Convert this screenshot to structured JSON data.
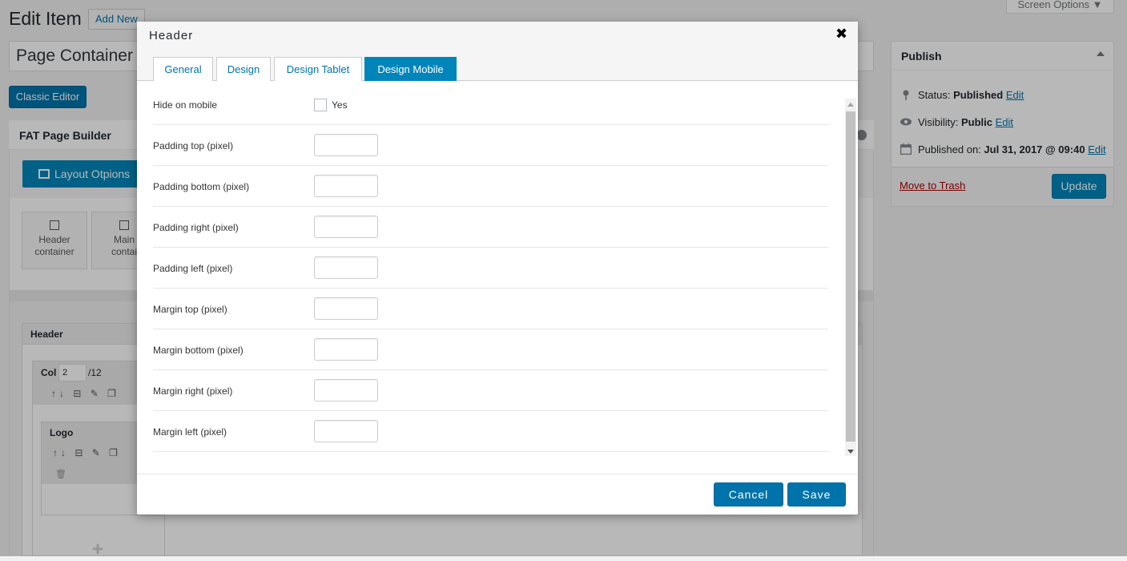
{
  "page": {
    "title": "Edit Item",
    "add_new": "Add New",
    "screen_options": "Screen Options ▼",
    "post_title": "Page Container",
    "classic_editor": "Classic Editor"
  },
  "builder": {
    "title": "FAT Page Builder",
    "layout_button": "Layout Otpions",
    "tiles": [
      {
        "line1": "Header",
        "line2": "container"
      },
      {
        "line1": "Main",
        "line2": "contai"
      }
    ],
    "header_panel_title": "Header",
    "col_label": "Col",
    "col_value": "2",
    "col_of": "/12",
    "logo_title": "Logo",
    "tools_glyphs": "↑↓ ⊟ ✎ ❐",
    "trash_glyph": "🗑",
    "plus_glyph": "+"
  },
  "publish": {
    "title": "Publish",
    "status_label": "Status:",
    "status_value": "Published",
    "visibility_label": "Visibility:",
    "visibility_value": "Public",
    "published_label": "Published on:",
    "published_value": "Jul 31, 2017 @ 09:40",
    "edit_link": "Edit",
    "trash": "Move to Trash",
    "update": "Update"
  },
  "modal": {
    "title": "Header",
    "close_glyph": "✖",
    "tabs": [
      {
        "label": "General",
        "active": false
      },
      {
        "label": "Design",
        "active": false
      },
      {
        "label": "Design Tablet",
        "active": false
      },
      {
        "label": "Design Mobile",
        "active": true
      }
    ],
    "hide_label": "Hide on mobile",
    "hide_checkbox_label": "Yes",
    "fields": [
      {
        "label": "Padding top (pixel)",
        "value": ""
      },
      {
        "label": "Padding bottom (pixel)",
        "value": ""
      },
      {
        "label": "Padding right (pixel)",
        "value": ""
      },
      {
        "label": "Padding left (pixel)",
        "value": ""
      },
      {
        "label": "Margin top (pixel)",
        "value": ""
      },
      {
        "label": "Margin bottom (pixel)",
        "value": ""
      },
      {
        "label": "Margin right (pixel)",
        "value": ""
      },
      {
        "label": "Margin left (pixel)",
        "value": ""
      }
    ],
    "cancel": "Cancel",
    "save": "Save"
  },
  "colors": {
    "primary_button": "#0073aa",
    "active_tab": "#0085ba",
    "link": "#0073aa",
    "trash_link": "#aa0000",
    "overlay": "rgba(0,0,0,0.28)"
  },
  "icons": {
    "close": "close-icon",
    "checkbox": "checkbox-icon",
    "pin": "pin-icon",
    "eye": "eye-icon",
    "calendar": "calendar-icon",
    "layout": "layout-icon",
    "chevron_up": "chevron-up-icon"
  }
}
